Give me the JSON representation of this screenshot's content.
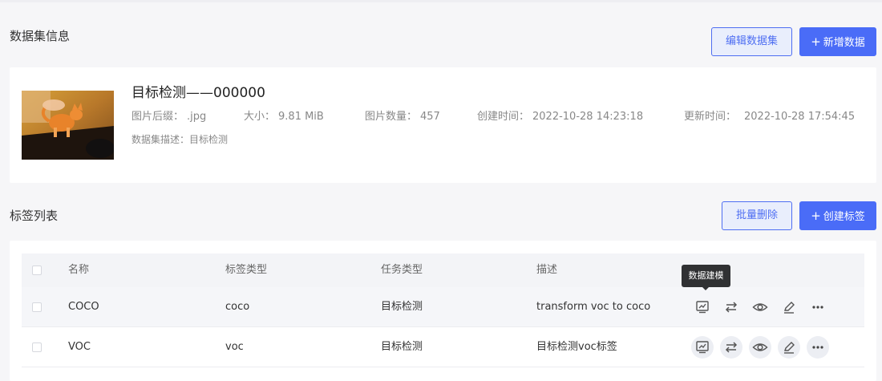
{
  "dataset_section": {
    "title": "数据集信息",
    "edit_button": "编辑数据集",
    "add_button": "新增数据",
    "add_icon": "plus-icon"
  },
  "dataset": {
    "name": "目标检测——000000",
    "suffix_label": "图片后缀：",
    "suffix": ".jpg",
    "size_label": "大小：",
    "size": "9.81 MiB",
    "count_label": "图片数量：",
    "count": "457",
    "created_label": "创建时间：",
    "created": "2022-10-28 14:23:18",
    "updated_label": "更新时间：",
    "updated": "2022-10-28 17:54:45",
    "desc_label": "数据集描述：",
    "desc": "目标检测"
  },
  "label_section": {
    "title": "标签列表",
    "batch_delete_button": "批量删除",
    "create_button": "创建标签",
    "create_icon": "plus-icon"
  },
  "table": {
    "columns": [
      "名称",
      "标签类型",
      "任务类型",
      "描述"
    ],
    "rows": [
      {
        "name": "COCO",
        "label_type": "coco",
        "task_type": "目标检测",
        "desc": "transform voc to coco"
      },
      {
        "name": "VOC",
        "label_type": "voc",
        "task_type": "目标检测",
        "desc": "目标检测voc标签"
      }
    ],
    "actions": [
      "data-modeling-icon",
      "convert-icon",
      "view-icon",
      "edit-icon",
      "more-icon"
    ]
  },
  "tooltip": {
    "text": "数据建模"
  },
  "colors": {
    "accent": "#4a6cf7",
    "page_bg": "#f6f6f8",
    "tooltip_bg": "#303133"
  }
}
